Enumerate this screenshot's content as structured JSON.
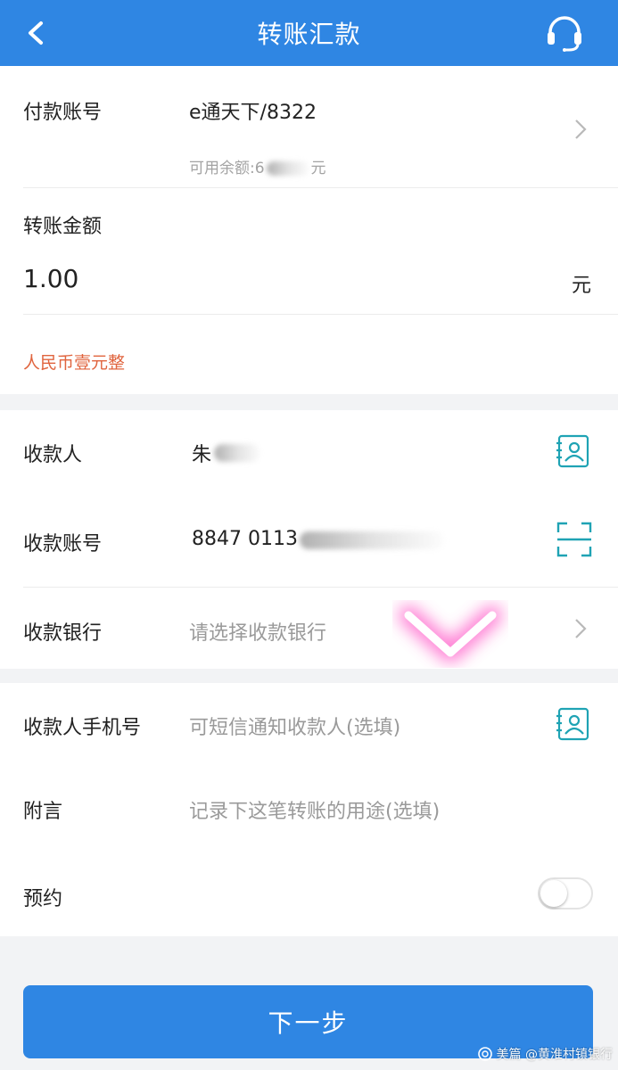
{
  "header": {
    "title": "转账汇款"
  },
  "payer": {
    "label": "付款账号",
    "account": "e通天下/8322",
    "balance_prefix": "可用余额:6",
    "balance_suffix": "元"
  },
  "amount": {
    "label": "转账金额",
    "value": "1.00",
    "unit": "元",
    "in_words": "人民币壹元整"
  },
  "payee": {
    "name_label": "收款人",
    "name_value": "朱",
    "account_label": "收款账号",
    "account_value": "8847 0113",
    "bank_label": "收款银行",
    "bank_placeholder": "请选择收款银行"
  },
  "extra": {
    "phone_label": "收款人手机号",
    "phone_placeholder": "可短信通知收款人(选填)",
    "memo_label": "附言",
    "memo_placeholder": "记录下这笔转账的用途(选填)",
    "schedule_label": "预约"
  },
  "actions": {
    "next_label": "下一步"
  },
  "watermark": {
    "text": "美篇 @黄淮村镇银行"
  },
  "colors": {
    "primary": "#2f86e3",
    "accent_teal": "#1fa3b4",
    "amount_words": "#e0643e",
    "highlight_pink": "#ff66cc"
  },
  "icons": {
    "back": "chevron-left-icon",
    "service": "headset-icon",
    "contact": "contact-card-icon",
    "scan": "scan-icon",
    "disclosure": "chevron-right-icon"
  }
}
